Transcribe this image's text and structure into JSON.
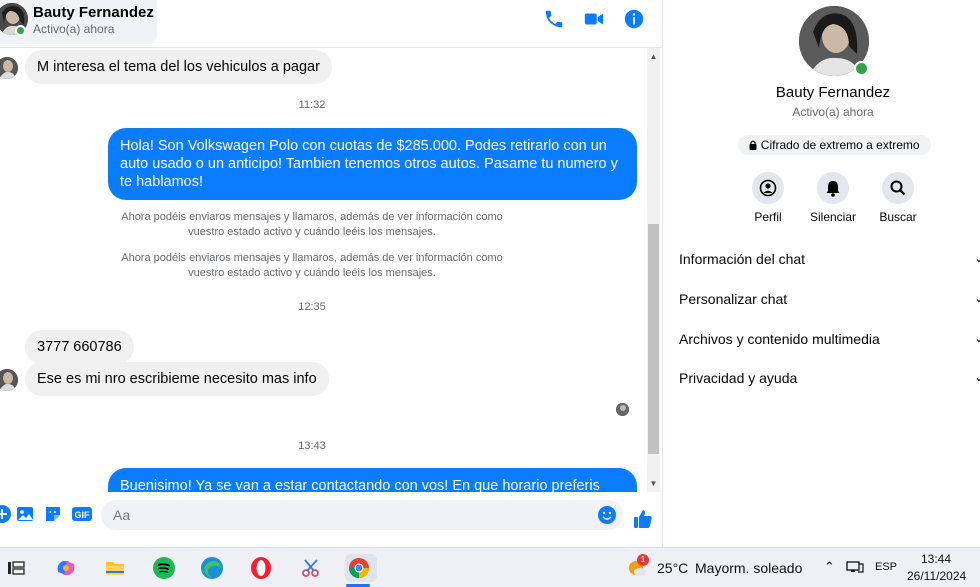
{
  "header": {
    "contact_name": "Bauty Fernandez",
    "contact_status": "Activo(a) ahora",
    "icons": [
      "phone-icon",
      "video-icon",
      "info-icon"
    ]
  },
  "messages": {
    "in1": "M interesa el tema del los vehiculos a pagar",
    "time1": "11:32",
    "out1": "Hola! Son Volkswagen Polo con cuotas de $285.000. Podes retirarlo con un auto usado o un anticipo! Tambien tenemos otros autos. Pasame tu numero y te hablamos!",
    "sys1": "Ahora podéis enviaros mensajes y llamaros, además de ver información como vuestro estado activo y cuándo leéis los mensajes.",
    "sys2": "Ahora podéis enviaros mensajes y llamaros, además de ver información como vuestro estado activo y cuándo leéis los mensajes.",
    "time2": "12:35",
    "in2": "3777 660786",
    "in3": "Ese es mi nro escribieme necesito mas info",
    "time3": "13:43",
    "out2": "Buenisimo! Ya se van a estar contactando con vos! En que horario preferis que se"
  },
  "composer": {
    "placeholder": "Aa",
    "icons": [
      "plus-icon",
      "image-icon",
      "sticker-icon",
      "gif-icon",
      "emoji-icon",
      "like-icon"
    ]
  },
  "profile": {
    "name": "Bauty Fernandez",
    "status": "Activo(a) ahora",
    "encryption": "Cifrado de extremo a extremo",
    "actions": [
      {
        "label": "Perfil",
        "icon": "profile-icon"
      },
      {
        "label": "Silenciar",
        "icon": "bell-icon"
      },
      {
        "label": "Buscar",
        "icon": "search-icon"
      }
    ],
    "sections": [
      "Información del chat",
      "Personalizar chat",
      "Archivos y contenido multimedia",
      "Privacidad y ayuda"
    ]
  },
  "taskbar": {
    "apps": [
      "task-view-icon",
      "copilot-icon",
      "file-explorer-icon",
      "spotify-icon",
      "edge-icon",
      "opera-icon",
      "snipping-icon",
      "chrome-icon"
    ],
    "weather_temp": "25°C",
    "weather_desc": "Mayorm. soleado",
    "weather_badge": "1",
    "language": "ESP",
    "time": "13:44",
    "date": "26/11/2024"
  },
  "colors": {
    "accent": "#0a7cff",
    "online": "#31a24c"
  }
}
